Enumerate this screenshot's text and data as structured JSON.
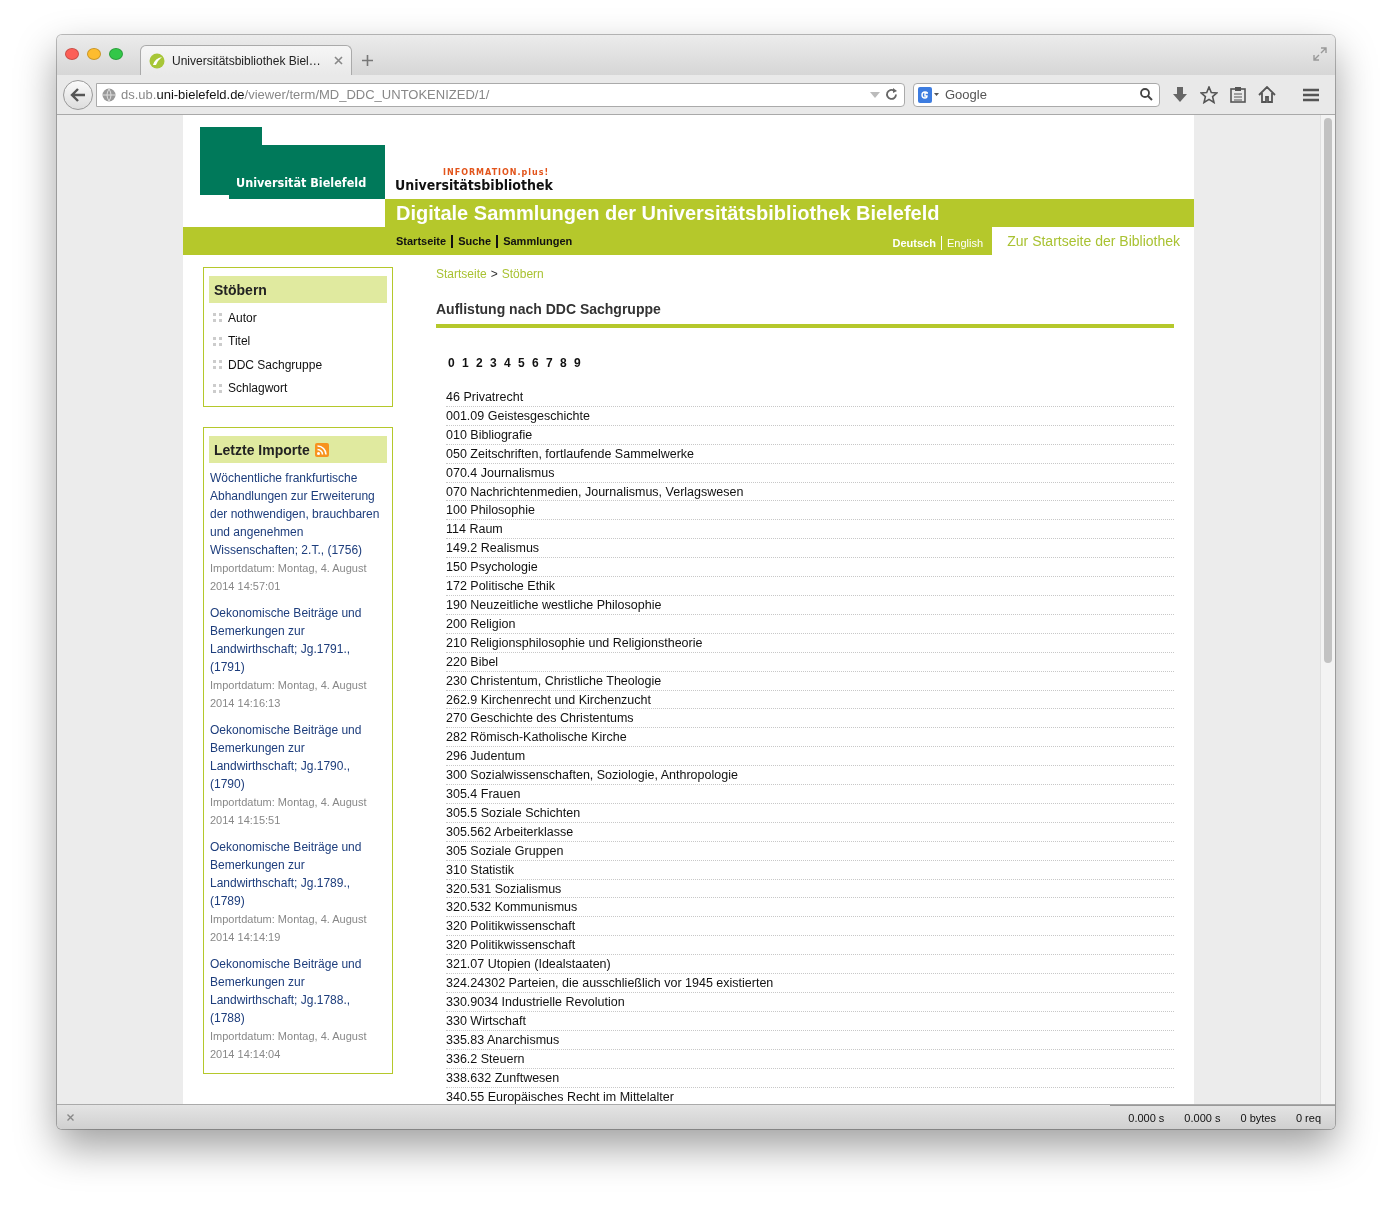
{
  "browser": {
    "tab_title": "Universitätsbibliothek Biel…",
    "url": {
      "prefix": "ds.ub.",
      "domain": "uni-bielefeld.de",
      "path": "/viewer/term/MD_DDC_UNTOKENIZED/1/"
    },
    "search_placeholder": "Google"
  },
  "header": {
    "university": "Universität Bielefeld",
    "tagline": "INFORMATION.plus!",
    "library": "Universitätsbibliothek",
    "title": "Digitale Sammlungen der Universitätsbibliothek Bielefeld",
    "nav": [
      "Startseite",
      "Suche",
      "Sammlungen"
    ],
    "languages": [
      {
        "label": "Deutsch",
        "selected": true
      },
      {
        "label": "English",
        "selected": false
      }
    ],
    "home_link": "Zur Startseite der Bibliothek"
  },
  "sidebar": {
    "browse": {
      "title": "Stöbern",
      "items": [
        "Autor",
        "Titel",
        "DDC Sachgruppe",
        "Schlagwort"
      ]
    },
    "imports": {
      "title": "Letzte Importe",
      "items": [
        {
          "title": "Wöchentliche frankfurtische Abhandlungen zur Erweiterung der nothwendigen, brauchbaren und angenehmen Wissenschaften; 2.T., (1756)",
          "date": "Importdatum: Montag, 4. August 2014 14:57:01"
        },
        {
          "title": "Oekonomische Beiträge und Bemerkungen zur Landwirthschaft; Jg.1791., (1791)",
          "date": "Importdatum: Montag, 4. August 2014 14:16:13"
        },
        {
          "title": "Oekonomische Beiträge und Bemerkungen zur Landwirthschaft; Jg.1790., (1790)",
          "date": "Importdatum: Montag, 4. August 2014 14:15:51"
        },
        {
          "title": "Oekonomische Beiträge und Bemerkungen zur Landwirthschaft; Jg.1789., (1789)",
          "date": "Importdatum: Montag, 4. August 2014 14:14:19"
        },
        {
          "title": "Oekonomische Beiträge und Bemerkungen zur Landwirthschaft; Jg.1788., (1788)",
          "date": "Importdatum: Montag, 4. August 2014 14:14:04"
        }
      ]
    }
  },
  "main": {
    "breadcrumb": {
      "items": [
        "Startseite",
        "Stöbern"
      ],
      "separator": ">"
    },
    "heading": "Auflistung nach DDC Sachgruppe",
    "index": [
      "0",
      "1",
      "2",
      "3",
      "4",
      "5",
      "6",
      "7",
      "8",
      "9"
    ],
    "entries": [
      "46 Privatrecht",
      "001.09 Geistesgeschichte",
      "010 Bibliografie",
      "050 Zeitschriften, fortlaufende Sammelwerke",
      "070.4 Journalismus",
      "070 Nachrichtenmedien, Journalismus, Verlagswesen",
      "100 Philosophie",
      "114 Raum",
      "149.2 Realismus",
      "150 Psychologie",
      "172 Politische Ethik",
      "190 Neuzeitliche westliche Philosophie",
      "200 Religion",
      "210 Religionsphilosophie und Religionstheorie",
      "220 Bibel",
      "230 Christentum, Christliche Theologie",
      "262.9 Kirchenrecht und Kirchenzucht",
      "270 Geschichte des Christentums",
      "282 Römisch-Katholische Kirche",
      "296 Judentum",
      "300 Sozialwissenschaften, Soziologie, Anthropologie",
      "305.4 Frauen",
      "305.5 Soziale Schichten",
      "305.562 Arbeiterklasse",
      "305 Soziale Gruppen",
      "310 Statistik",
      "320.531 Sozialismus",
      "320.532 Kommunismus",
      "320 Politikwissenschaft",
      "320 Politikwissenschaft",
      "321.07 Utopien (Idealstaaten)",
      "324.24302 Parteien, die ausschließlich vor 1945 existierten",
      "330.9034 Industrielle Revolution",
      "330 Wirtschaft",
      "335.83 Anarchismus",
      "336.2 Steuern",
      "338.632 Zunftwesen",
      "340.55 Europäisches Recht im Mittelalter"
    ]
  },
  "status_bar": [
    "0.000 s",
    "0.000 s",
    "0 bytes",
    "0 req"
  ]
}
